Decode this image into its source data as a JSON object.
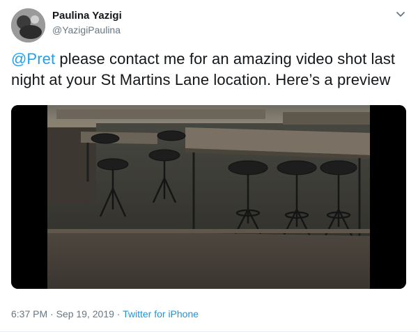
{
  "author": {
    "name": "Paulina Yazigi",
    "handle": "@YazigiPaulina",
    "avatar_icon": "profile-photo"
  },
  "tweet": {
    "mention": "@Pret",
    "body": " please contact me for an amazing video shot last night at your St Martins Lane location. Here’s a preview"
  },
  "media": {
    "type": "video",
    "icon": "video-thumbnail"
  },
  "meta": {
    "time": "6:37 PM",
    "separator1": " · ",
    "date": "Sep 19, 2019",
    "separator2": " · ",
    "source": "Twitter for iPhone"
  },
  "colors": {
    "link": "#1da1f2",
    "secondary_text": "#657786",
    "primary_text": "#14171a"
  }
}
